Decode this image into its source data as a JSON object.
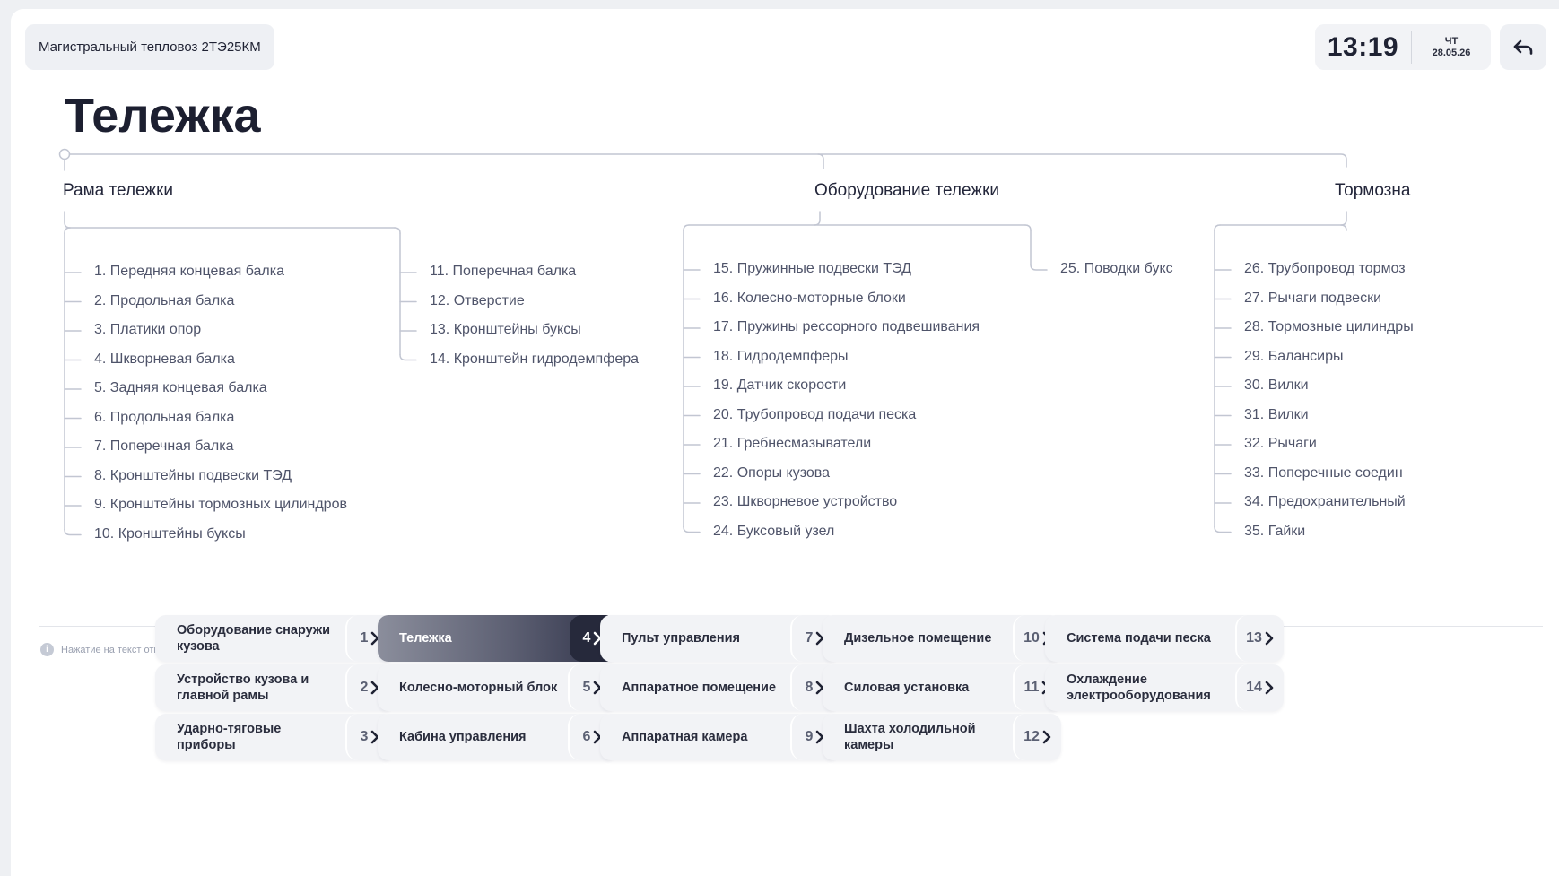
{
  "header": {
    "app_title": "Магистральный тепловоз 2ТЭ25КМ",
    "time": "13:19",
    "weekday": "ЧТ",
    "date": "28.05.26"
  },
  "page": {
    "title": "Тележка"
  },
  "tree": {
    "groups": [
      {
        "title": "Рама тележки",
        "columns": [
          [
            "1. Передняя концевая балка",
            "2. Продольная балка",
            "3. Платики опор",
            "4. Шкворневая балка",
            "5. Задняя концевая балка",
            "6. Продольная балка",
            "7. Поперечная балка",
            "8. Кронштейны подвески ТЭД",
            "9. Кронштейны тормозных цилиндров",
            "10. Кронштейны буксы"
          ],
          [
            "11. Поперечная балка",
            "12. Отверстие",
            "13. Кронштейны буксы",
            "14. Кронштейн гидродемпфера"
          ]
        ]
      },
      {
        "title": "Оборудование тележки",
        "columns": [
          [
            "15. Пружинные подвески ТЭД",
            "16. Колесно-моторные блоки",
            "17. Пружины рессорного подвешивания",
            "18. Гидродемпферы",
            "19. Датчик скорости",
            "20. Трубопровод подачи песка",
            "21. Гребнесмазыватели",
            "22. Опоры кузова",
            "23. Шкворневое устройство",
            "24. Буксовый узел"
          ],
          [
            "25. Поводки букс"
          ]
        ]
      },
      {
        "title": "Тормозна",
        "columns": [
          [
            "26. Трубопровод тормоз",
            "27. Рычаги подвески",
            "28. Тормозные цилиндры",
            "29. Балансиры",
            "30. Вилки",
            "31. Вилки",
            "32. Рычаги",
            "33. Поперечные соедин",
            "34. Предохранительный",
            "35. Гайки"
          ]
        ]
      }
    ]
  },
  "hint": "Нажатие на текст открывает древо, нажатие на цифру открывает плакат",
  "nav": [
    {
      "label": "Оборудование снаружи кузова",
      "num": "1",
      "active": false
    },
    {
      "label": "Устройство кузова и главной рамы",
      "num": "2",
      "active": false
    },
    {
      "label": "Ударно-тяговые приборы",
      "num": "3",
      "active": false
    },
    {
      "label": "Тележка",
      "num": "4",
      "active": true
    },
    {
      "label": "Колесно-моторный блок",
      "num": "5",
      "active": false
    },
    {
      "label": "Кабина управления",
      "num": "6",
      "active": false
    },
    {
      "label": "Пульт управления",
      "num": "7",
      "active": false
    },
    {
      "label": "Аппаратное помещение",
      "num": "8",
      "active": false
    },
    {
      "label": "Аппаратная камера",
      "num": "9",
      "active": false
    },
    {
      "label": "Дизельное помещение",
      "num": "10",
      "active": false
    },
    {
      "label": "Силовая установка",
      "num": "11",
      "active": false
    },
    {
      "label": "Шахта холодильной камеры",
      "num": "12",
      "active": false
    },
    {
      "label": "Система подачи песка",
      "num": "13",
      "active": false
    },
    {
      "label": "Охлаждение электрооборудования",
      "num": "14",
      "active": false
    }
  ],
  "icons": {
    "back": "back-arrow-icon",
    "info": "info-icon",
    "chevron": "chevron-right-icon"
  },
  "colors": {
    "accent_dark": "#26293b",
    "tree_line": "#c2c6d2",
    "chip_bg": "#f2f3f6"
  }
}
